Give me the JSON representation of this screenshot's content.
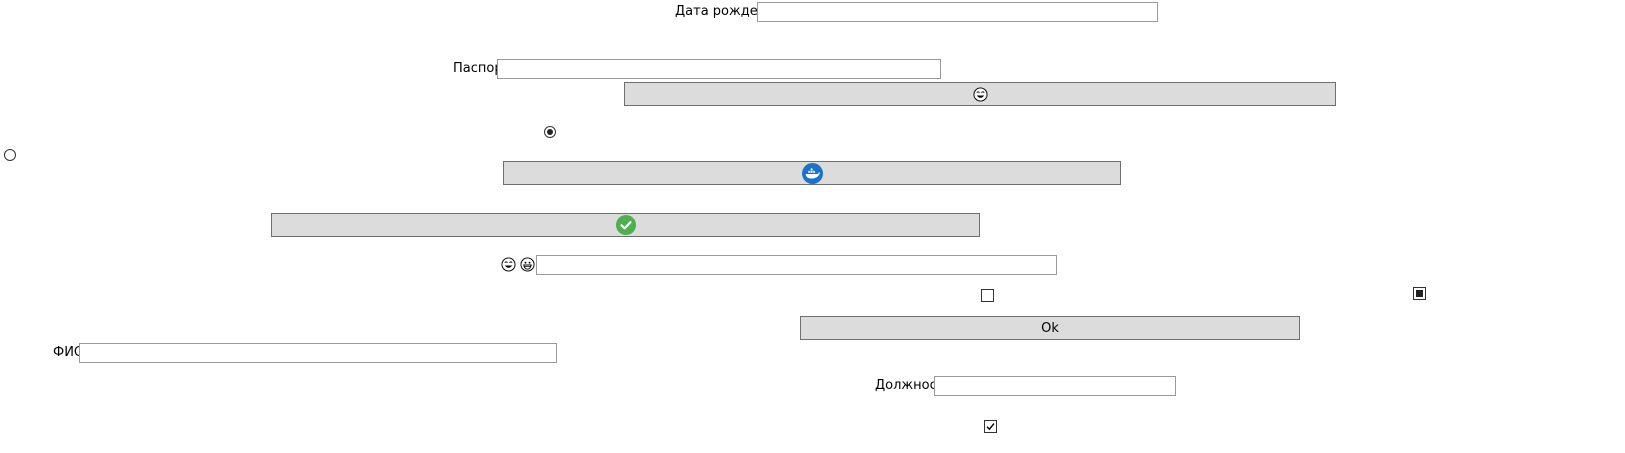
{
  "form": {
    "birth_date_label": "Дата рождения",
    "birth_date_value": "",
    "passport_label": "Паспорт",
    "passport_value": "",
    "fio_label": "ФИО",
    "fio_value": "",
    "position_label": "Должность",
    "position_value": "",
    "emoji_field_value": ""
  },
  "buttons": {
    "ok_label": "Ok"
  },
  "icons": {
    "laughing_face": "laughing-face-icon",
    "grinning_face": "grinning-face-icon",
    "whale": "whale-icon",
    "check_circle": "check-circle-icon"
  },
  "states": {
    "radio_top": "selected",
    "radio_left": "unselected",
    "checkbox_middle": "unchecked",
    "checkbox_right": "indeterminate",
    "checkbox_bottom": "checked"
  },
  "colors": {
    "button_bg": "#dcdcdc",
    "whale_blue": "#1a73c8",
    "check_green": "#4caf50"
  }
}
